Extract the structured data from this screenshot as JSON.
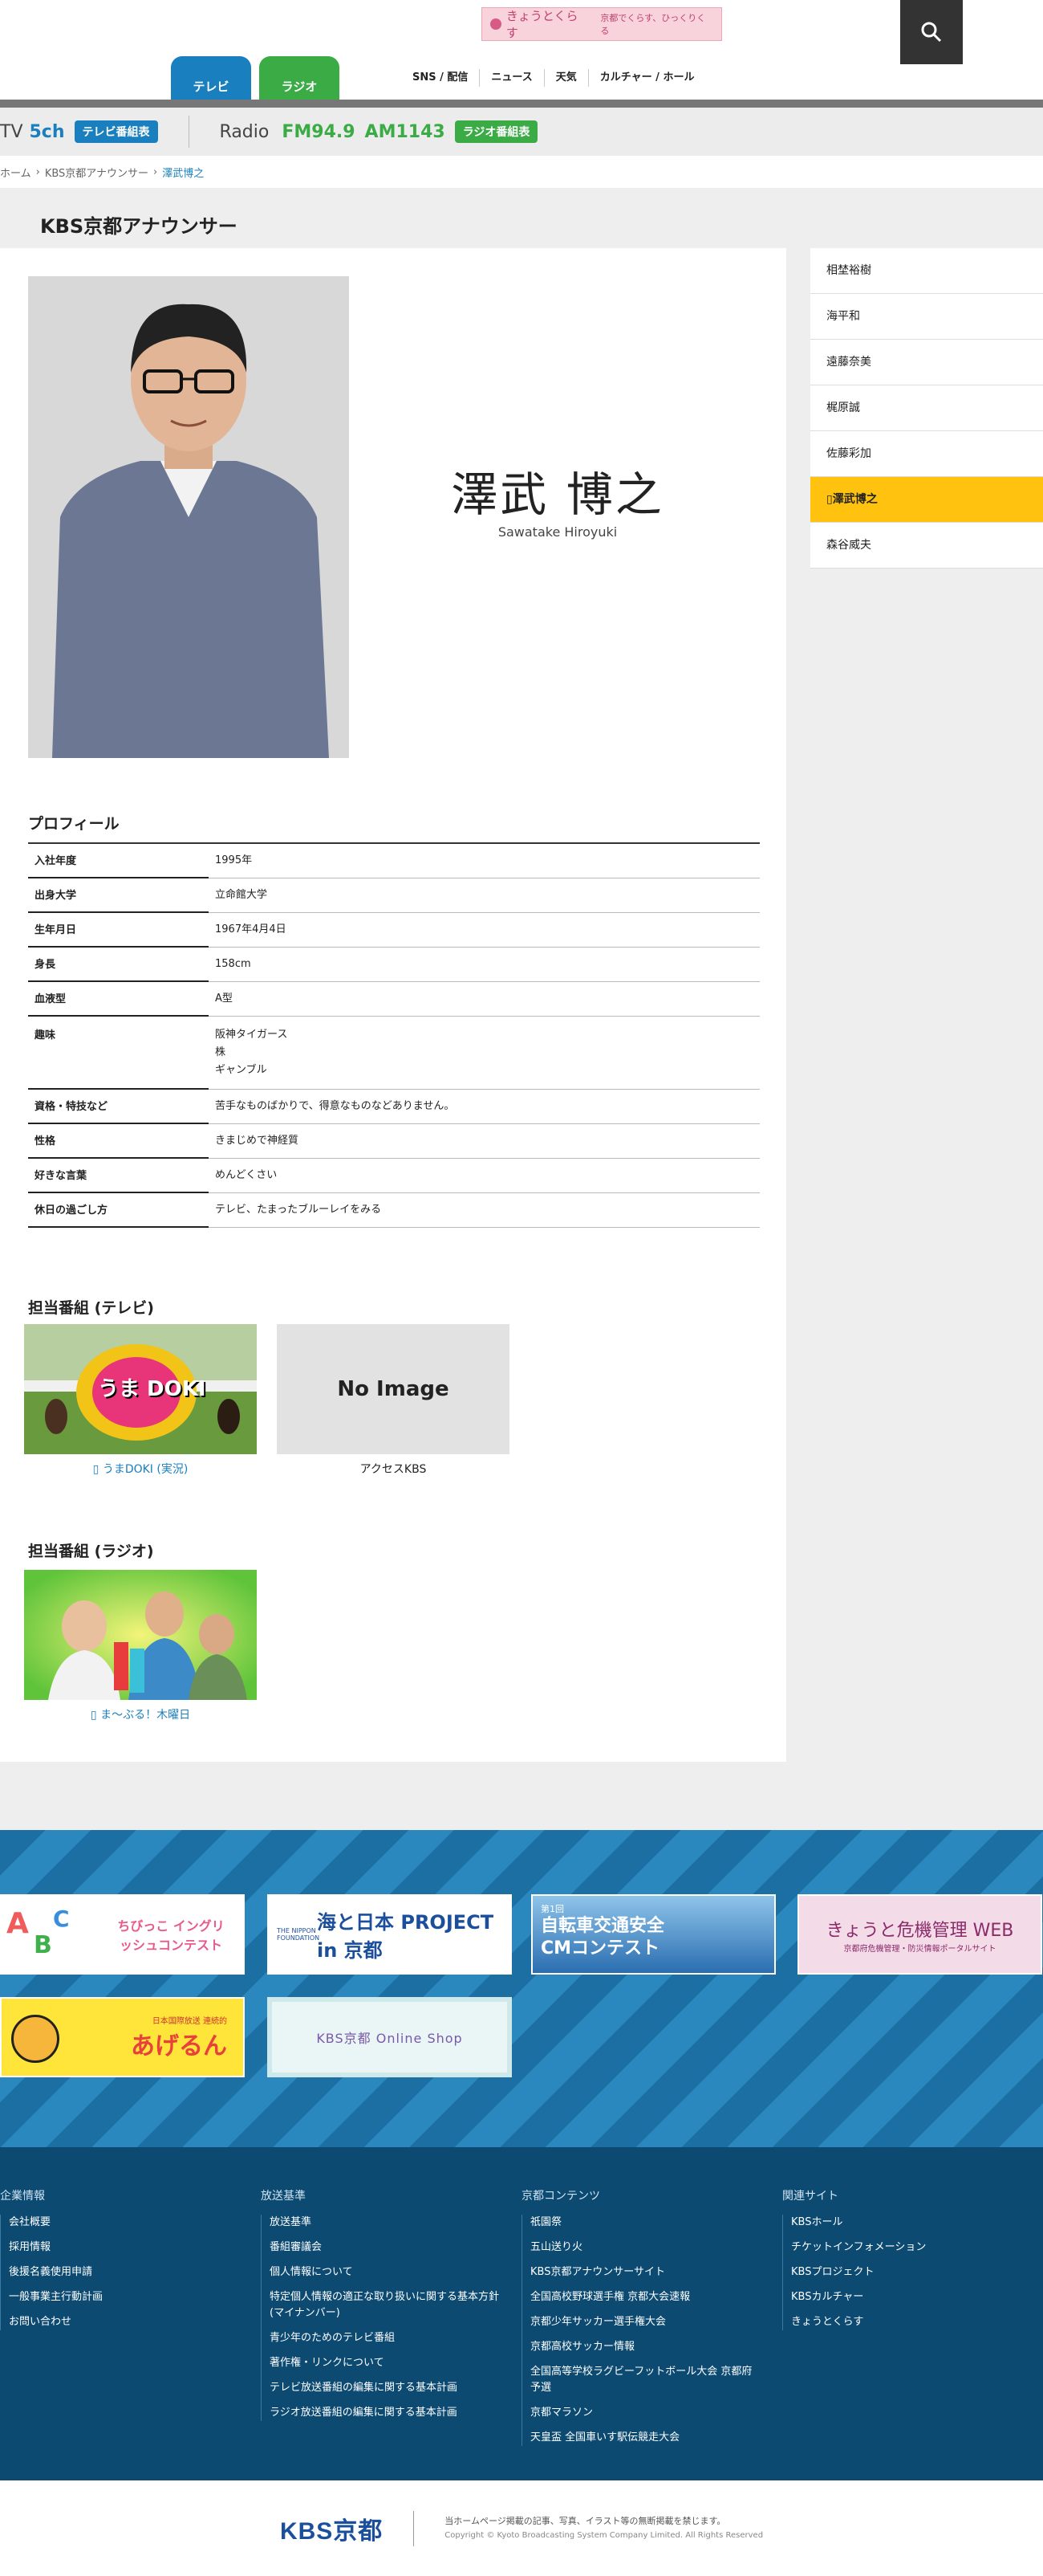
{
  "header": {
    "promo_title": "きょうとくらす",
    "promo_sub": "京都でくらす、ひっくりくる",
    "tabs": [
      {
        "label": "テレビ"
      },
      {
        "label": "ラジオ"
      }
    ],
    "nav": [
      "SNS / 配信",
      "ニュース",
      "天気",
      "カルチャー / ホール"
    ]
  },
  "broadcast": {
    "tv_label": "TV",
    "tv_channel": "5ch",
    "tv_button": "テレビ番組表",
    "radio_label": "Radio",
    "fm": "FM94.9",
    "am": "AM1143",
    "radio_button": "ラジオ番組表"
  },
  "breadcrumb": [
    "ホーム",
    "KBS京都アナウンサー",
    "澤武博之"
  ],
  "page_title": "KBS京都アナウンサー",
  "profile": {
    "name_jp": "澤武 博之",
    "name_en": "Sawatake Hiroyuki",
    "section_title": "プロフィール",
    "rows": [
      {
        "k": "入社年度",
        "v": "1995年"
      },
      {
        "k": "出身大学",
        "v": "立命館大学"
      },
      {
        "k": "生年月日",
        "v": "1967年4月4日"
      },
      {
        "k": "身長",
        "v": "158cm"
      },
      {
        "k": "血液型",
        "v": "A型"
      },
      {
        "k": "趣味",
        "v": "阪神タイガース\n株\nギャンブル"
      },
      {
        "k": "資格・特技など",
        "v": "苦手なものばかりで、得意なものなどありません。"
      },
      {
        "k": "性格",
        "v": "きまじめで神経質"
      },
      {
        "k": "好きな言葉",
        "v": "めんどくさい"
      },
      {
        "k": "休日の過ごし方",
        "v": "テレビ、たまったブルーレイをみる"
      }
    ]
  },
  "tv_programs": {
    "title": "担当番組 (テレビ)",
    "items": [
      {
        "caption": "うまDOKI (実況)",
        "logo": "うま DOKI"
      },
      {
        "caption": "アクセスKBS",
        "noimage": "No Image"
      }
    ]
  },
  "radio_programs": {
    "title": "担当番組 (ラジオ)",
    "items": [
      {
        "caption": "ま〜ぶる！木曜日"
      }
    ]
  },
  "sidebar": [
    "相埜裕樹",
    "海平和",
    "遠藤奈美",
    "梶原誠",
    "佐藤彩加",
    "澤武博之",
    "森谷威夫"
  ],
  "banners": [
    {
      "text": "ちびっこ イングリッシュコンテスト"
    },
    {
      "text": "海と日本 PROJECT in 京都",
      "small": "THE NIPPON FOUNDATION"
    },
    {
      "text": "自転車交通安全CMコンテスト",
      "small": "第1回"
    },
    {
      "text": "きょうと危機管理 WEB",
      "small": "京都府危機管理・防災情報ポータルサイト"
    },
    {
      "text": "あげるん",
      "small": "日本国際放送 連続的"
    },
    {
      "text": "KBS京都 Online Shop"
    }
  ],
  "footer": {
    "cols": [
      {
        "title": "企業情報",
        "items": [
          "会社概要",
          "採用情報",
          "後援名義使用申請",
          "一般事業主行動計画",
          "お問い合わせ"
        ]
      },
      {
        "title": "放送基準",
        "items": [
          "放送基準",
          "番組審議会",
          "個人情報について",
          "特定個人情報の適正な取り扱いに関する基本方針(マイナンバー)",
          "青少年のためのテレビ番組",
          "著作権・リンクについて",
          "テレビ放送番組の編集に関する基本計画",
          "ラジオ放送番組の編集に関する基本計画"
        ]
      },
      {
        "title": "京都コンテンツ",
        "items": [
          "祇園祭",
          "五山送り火",
          "KBS京都アナウンサーサイト",
          "全国高校野球選手権 京都大会速報",
          "京都少年サッカー選手権大会",
          "京都高校サッカー情報",
          "全国高等学校ラグビーフットボール大会 京都府予選",
          "京都マラソン",
          "天皇盃 全国車いす駅伝競走大会"
        ]
      },
      {
        "title": "関連サイト",
        "items": [
          "KBSホール",
          "チケットインフォメーション",
          "KBSプロジェクト",
          "KBSカルチャー",
          "きょうとくらす"
        ]
      }
    ],
    "logo": "KBS京都",
    "notice": "当ホームページ掲載の記事、写真、イラスト等の無断掲載を禁じます。",
    "copyright": "Copyright © Kyoto Broadcasting System Company Limited. All Rights Reserved"
  }
}
